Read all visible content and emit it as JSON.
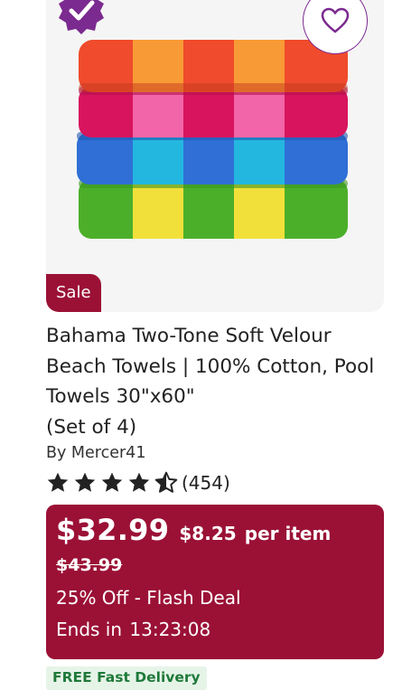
{
  "product": {
    "sale_badge": "Sale",
    "title_lines": [
      "Bahama Two-Tone Soft Velour",
      "Beach Towels | 100% Cotton, Pool",
      "Towels 30\"x60\"",
      "(Set of 4)"
    ],
    "brand": "By Mercer41",
    "rating": 4.5,
    "rating_count": "(454)",
    "price": "$32.99",
    "per_item_price": "$8.25",
    "per_item_label": "per item",
    "original_price": "$43.99",
    "deal_text": "25% Off - Flash Deal",
    "ends_label": "Ends in",
    "ends_time": "13:23:08",
    "delivery": "FREE Fast Delivery"
  },
  "icons": {
    "badge": "check-badge-icon",
    "wishlist": "heart-icon",
    "star": "star-icon"
  },
  "colors": {
    "accent": "#9b1136",
    "badge_purple": "#7b2a8f",
    "delivery_green": "#1f7a3a"
  }
}
